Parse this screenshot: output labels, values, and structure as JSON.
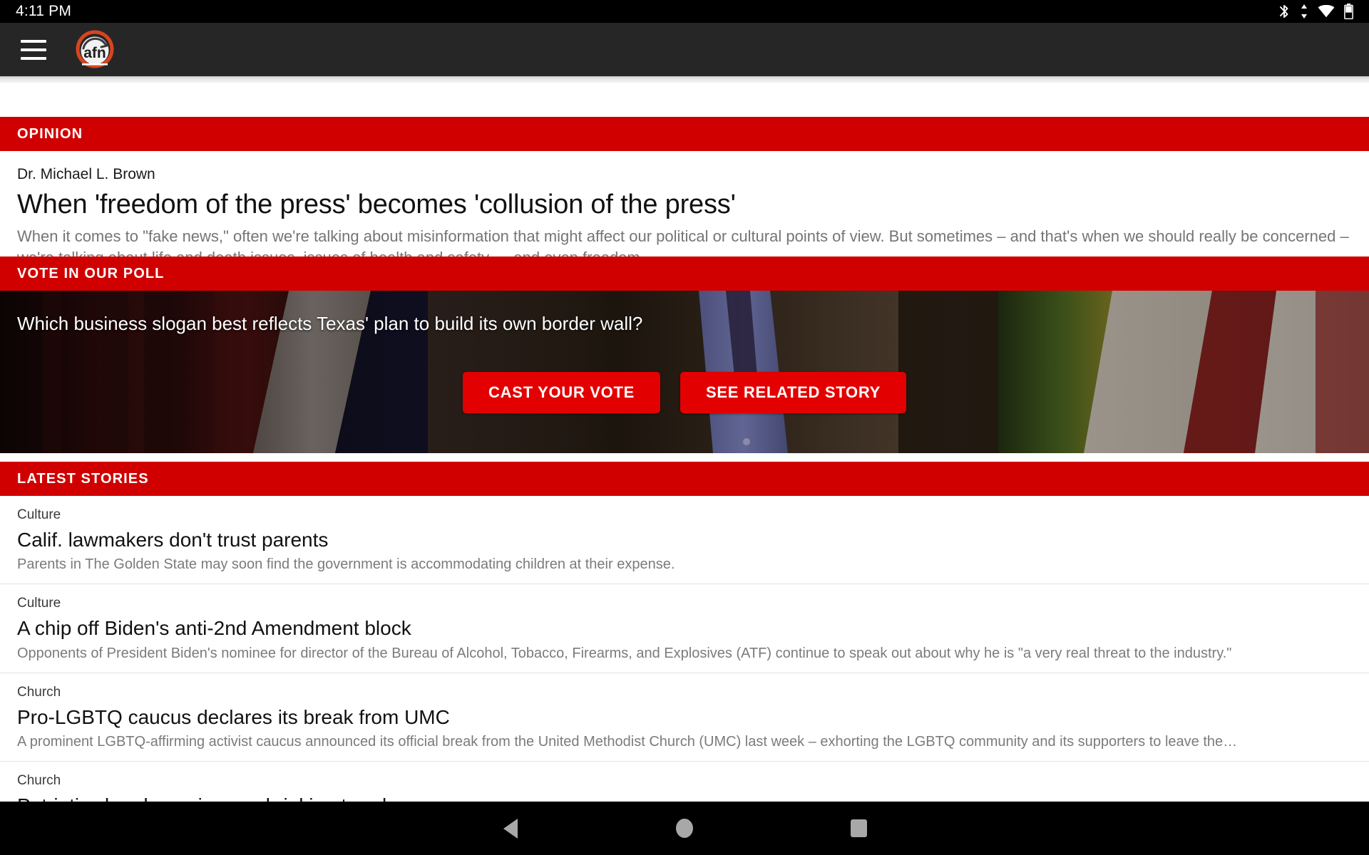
{
  "status_bar": {
    "time": "4:11 PM",
    "icons": [
      "bluetooth-icon",
      "data-transfer-icon",
      "wifi-icon",
      "battery-icon"
    ]
  },
  "header": {
    "menu_icon": "hamburger-menu-icon",
    "logo_text": "afn",
    "logo_name": "afn-logo",
    "background_color": "#262626"
  },
  "theme": {
    "accent_red": "#d10000",
    "button_red": "#e30000",
    "text_dark": "#111111",
    "text_muted": "#757575"
  },
  "opinion": {
    "banner_label": "OPINION",
    "author": "Dr. Michael L. Brown",
    "title": "When 'freedom of the press' becomes 'collusion of the press'",
    "summary": "When it comes to \"fake news,\" often we're talking about misinformation that might affect our political or cultural points of view. But sometimes – and that's when we should really be concerned – we're talking about life and death issues, issues of health and safety … and even freedom."
  },
  "poll": {
    "banner_label": "VOTE IN OUR POLL",
    "question": "Which business slogan best reflects Texas' plan to build its own border wall?",
    "primary_button": "CAST YOUR VOTE",
    "secondary_button": "SEE RELATED STORY"
  },
  "latest": {
    "banner_label": "LATEST STORIES",
    "stories": [
      {
        "category": "Culture",
        "title": "Calif. lawmakers don't trust parents",
        "summary": "Parents in The Golden State may soon find the government is accommodating children at their expense."
      },
      {
        "category": "Culture",
        "title": "A chip off Biden's anti-2nd Amendment block",
        "summary": "Opponents of President Biden's nominee for director of the Bureau of Alcohol, Tobacco, Firearms, and Explosives (ATF) continue to speak out about why he is \"a very real threat to the industry.\""
      },
      {
        "category": "Church",
        "title": "Pro-LGBTQ caucus declares its break from UMC",
        "summary": "A prominent LGBTQ-affirming activist caucus announced its official break from the United Methodist Church (UMC) last week – exhorting the LGBTQ community and its supporters to leave the…"
      },
      {
        "category": "Church",
        "title": "Patriotic church services a shrinking trend",
        "summary": ""
      }
    ]
  },
  "nav_bar": {
    "back_label": "back-button",
    "home_label": "home-button",
    "recents_label": "recents-button"
  }
}
